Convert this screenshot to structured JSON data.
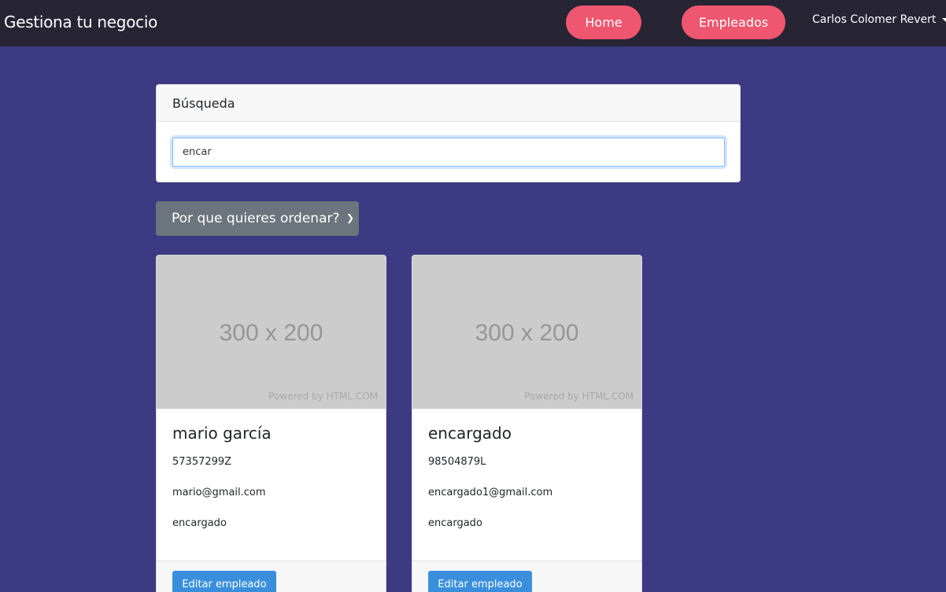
{
  "navbar": {
    "brand": "Gestiona tu negocio",
    "links": [
      {
        "label": "Home"
      },
      {
        "label": "Empleados"
      }
    ],
    "user": "Carlos Colomer Revert"
  },
  "search": {
    "title": "Búsqueda",
    "value": "encar"
  },
  "sort": {
    "label": "Por que quieres ordenar?"
  },
  "employees": [
    {
      "image_dims": "300 x 200",
      "image_credit": "Powered by HTML.COM",
      "name": "mario garcía",
      "dni": "57357299Z",
      "email": "mario@gmail.com",
      "role": "encargado",
      "edit_label": "Editar empleado"
    },
    {
      "image_dims": "300 x 200",
      "image_credit": "Powered by HTML.COM",
      "name": "encargado",
      "dni": "98504879L",
      "email": "encargado1@gmail.com",
      "role": "encargado",
      "edit_label": "Editar empleado"
    }
  ],
  "colors": {
    "background": "#3b3a82",
    "navbar": "#272434",
    "accent_pink": "#ef5670",
    "button_blue": "#3a8fdd",
    "select_gray": "#6c757d"
  }
}
